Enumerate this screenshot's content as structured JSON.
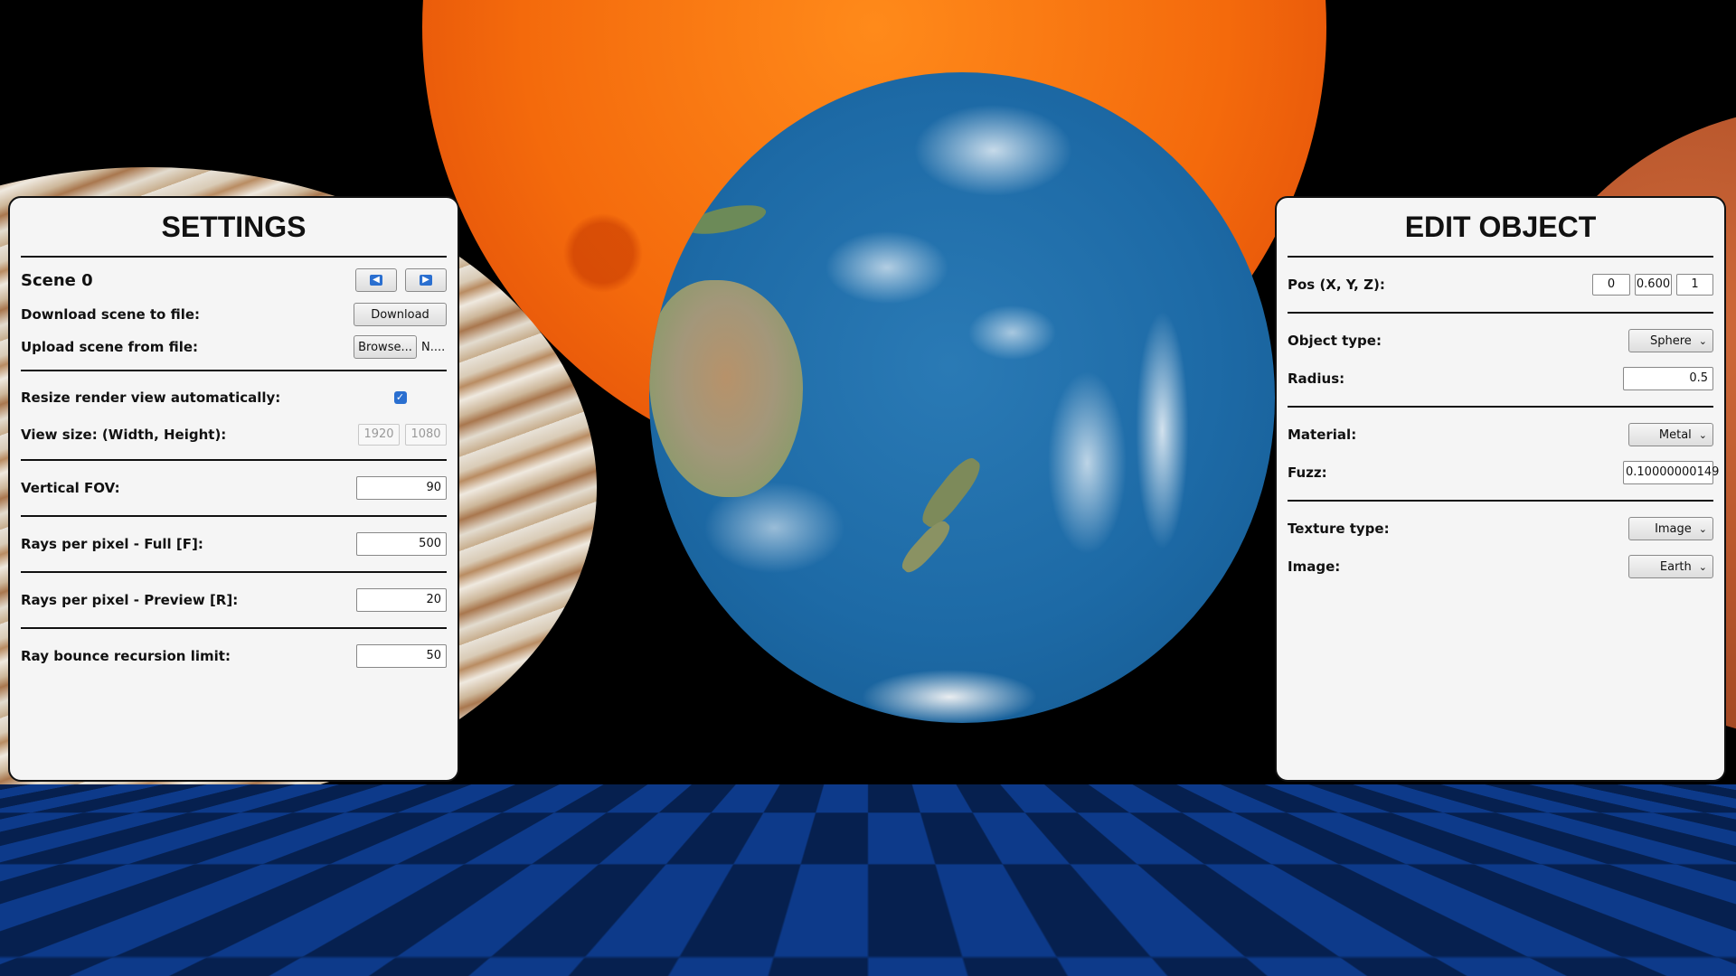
{
  "settings": {
    "title": "SETTINGS",
    "scene_label": "Scene 0",
    "prev_icon": "arrow-left-icon",
    "next_icon": "arrow-right-icon",
    "download_label": "Download scene to file:",
    "download_button": "Download",
    "upload_label": "Upload scene from file:",
    "browse_button": "Browse...",
    "file_name": "N....",
    "resize_label": "Resize render view automatically:",
    "resize_checked": true,
    "view_size_label": "View size: (Width, Height):",
    "view_width": "1920",
    "view_height": "1080",
    "fov_label": "Vertical FOV:",
    "fov_value": "90",
    "rays_full_label": "Rays per pixel - Full [F]:",
    "rays_full_value": "500",
    "rays_preview_label": "Rays per pixel - Preview [R]:",
    "rays_preview_value": "20",
    "bounce_label": "Ray bounce recursion limit:",
    "bounce_value": "50"
  },
  "edit_object": {
    "title": "EDIT OBJECT",
    "pos_label": "Pos (X, Y, Z):",
    "pos_x": "0",
    "pos_y": "0.600",
    "pos_z": "1",
    "type_label": "Object type:",
    "type_value": "Sphere",
    "radius_label": "Radius:",
    "radius_value": "0.5",
    "material_label": "Material:",
    "material_value": "Metal",
    "fuzz_label": "Fuzz:",
    "fuzz_value": "0.10000000149",
    "texture_label": "Texture type:",
    "texture_value": "Image",
    "image_label": "Image:",
    "image_value": "Earth"
  },
  "colors": {
    "panel_bg": "#f5f5f5",
    "accent": "#2a6fd0",
    "floor_dark": "#06204f",
    "floor_light": "#0d3a8a"
  }
}
